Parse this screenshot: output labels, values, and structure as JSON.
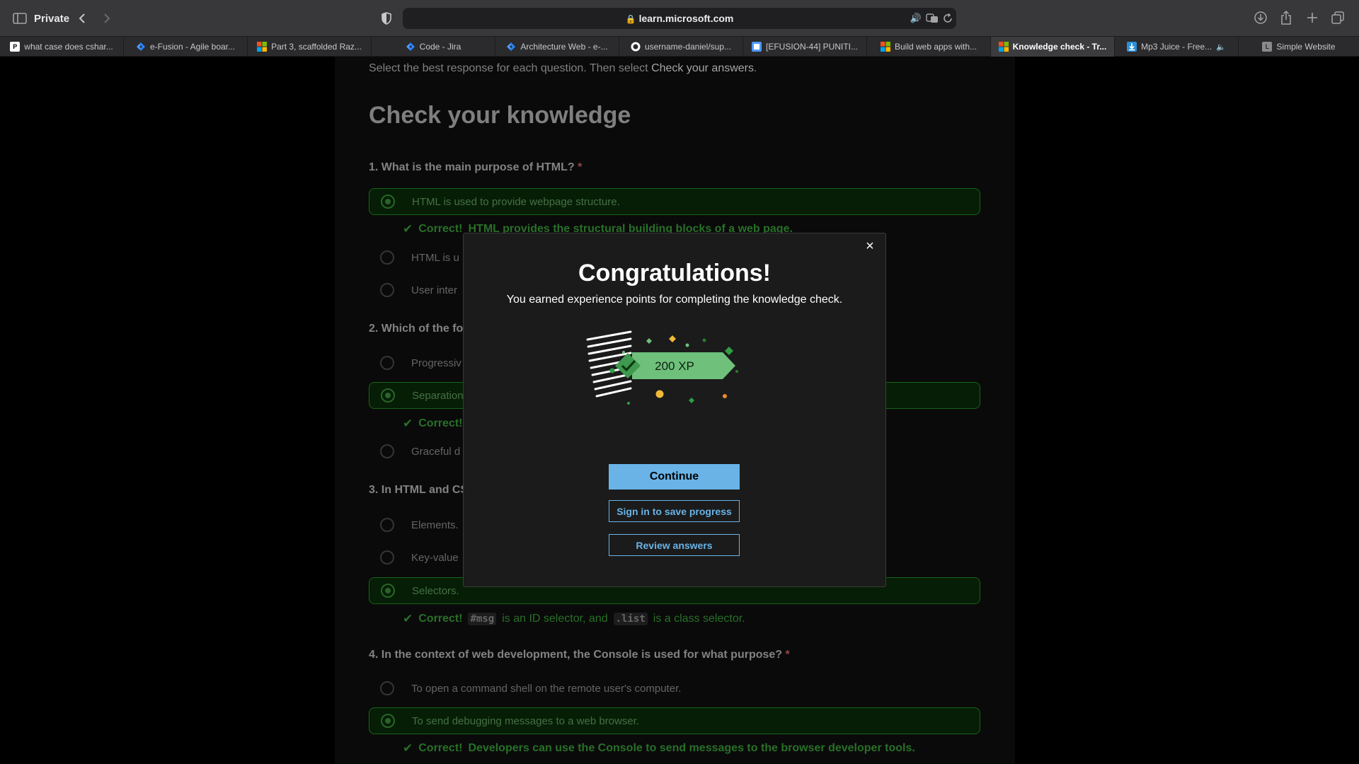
{
  "browser": {
    "private_label": "Private",
    "url": "learn.microsoft.com",
    "tabs": [
      {
        "label": "what case does cshar...",
        "icon": "perplexity-icon"
      },
      {
        "label": "e-Fusion - Agile boar...",
        "icon": "jira-icon"
      },
      {
        "label": "Part 3, scaffolded Raz...",
        "icon": "microsoft-icon"
      },
      {
        "label": "Code - Jira",
        "icon": "jira-icon"
      },
      {
        "label": "Architecture Web - e-...",
        "icon": "jira-icon"
      },
      {
        "label": "username-daniel/sup...",
        "icon": "github-icon"
      },
      {
        "label": "[EFUSION-44] PUNITI...",
        "icon": "jira-icon"
      },
      {
        "label": "Build web apps with...",
        "icon": "microsoft-icon"
      },
      {
        "label": "Knowledge check - Tr...",
        "icon": "microsoft-icon"
      },
      {
        "label": "Mp3 Juice - Free...",
        "icon": "download-icon"
      },
      {
        "label": "Simple Website",
        "icon": "letter-l-icon",
        "icon_letter": "L"
      }
    ]
  },
  "page": {
    "intro_prefix": "Select the best response for each question. Then select ",
    "intro_bold": "Check your answers",
    "intro_suffix": ".",
    "title": "Check your knowledge",
    "q1": {
      "text": "1. What is the main purpose of HTML?",
      "required": "*",
      "options": [
        "HTML is used to provide webpage structure.",
        "HTML is u",
        "User inter"
      ],
      "feedback_label": "Correct!",
      "feedback_text": "HTML provides the structural building blocks of a web page."
    },
    "q2": {
      "text": "2. Which of the fol",
      "options": [
        "Progressiv",
        "Separation",
        "Graceful d"
      ],
      "feedback_label": "Correct!"
    },
    "q3": {
      "text": "3. In HTML and CS",
      "options": [
        "Elements.",
        "Key-value",
        "Selectors."
      ],
      "feedback_label": "Correct!",
      "feedback_code1": "#msg",
      "feedback_mid": "is an ID selector, and",
      "feedback_code2": ".list",
      "feedback_end": "is a class selector."
    },
    "q4": {
      "text": "4. In the context of web development, the Console is used for what purpose?",
      "required": "*",
      "options": [
        "To open a command shell on the remote user's computer.",
        "To send debugging messages to a web browser."
      ],
      "feedback_label": "Correct!",
      "feedback_text": "Developers can use the Console to send messages to the browser developer tools."
    }
  },
  "modal": {
    "close": "×",
    "title": "Congratulations!",
    "subtitle": "You earned experience points for completing the knowledge check.",
    "xp_label": "200 XP",
    "continue": "Continue",
    "signin": "Sign in to save progress",
    "review": "Review answers"
  },
  "colors": {
    "accent": "#69b3e7",
    "success": "#2c7a2c",
    "xp_green": "#6ec07a"
  }
}
